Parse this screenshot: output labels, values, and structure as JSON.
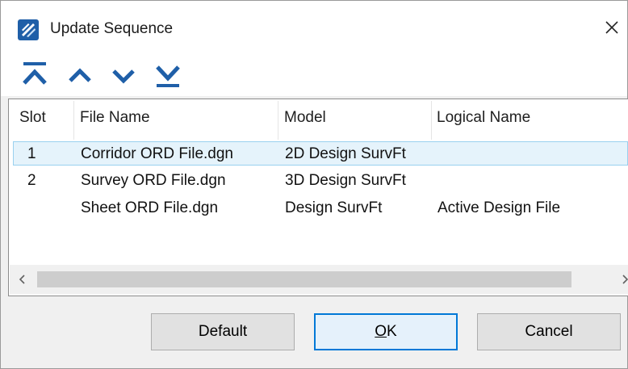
{
  "window": {
    "title": "Update Sequence"
  },
  "toolbar": {
    "buttons": [
      {
        "icon": "move-to-top-icon"
      },
      {
        "icon": "move-up-icon"
      },
      {
        "icon": "move-down-icon"
      },
      {
        "icon": "move-to-bottom-icon"
      }
    ]
  },
  "table": {
    "headers": {
      "slot": "Slot",
      "file_name": "File Name",
      "model": "Model",
      "logical_name": "Logical Name"
    },
    "rows": [
      {
        "slot": "1",
        "file_name": "Corridor ORD File.dgn",
        "model": "2D Design SurvFt",
        "logical_name": "",
        "selected": true
      },
      {
        "slot": "2",
        "file_name": "Survey ORD File.dgn",
        "model": "3D Design SurvFt",
        "logical_name": "",
        "selected": false
      },
      {
        "slot": "",
        "file_name": "Sheet ORD File.dgn",
        "model": "Design SurvFt",
        "logical_name": "Active Design File",
        "selected": false
      }
    ]
  },
  "buttons": {
    "default": "Default",
    "ok_prefix": "",
    "ok_underlined": "O",
    "ok_suffix": "K",
    "cancel": "Cancel"
  },
  "colors": {
    "accent": "#0078d7",
    "icon_blue": "#1f5fa8",
    "selection": "#e5f3fb"
  }
}
